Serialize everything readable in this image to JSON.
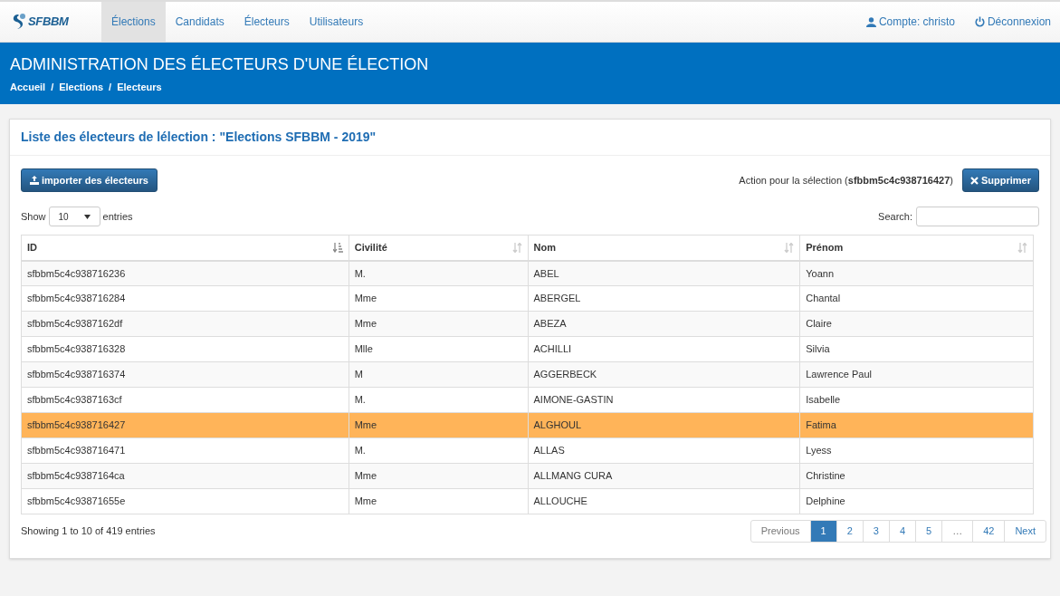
{
  "navbar": {
    "logo_text": "SFBBM",
    "items": [
      {
        "label": "Élections",
        "selected": true
      },
      {
        "label": "Candidats",
        "selected": false
      },
      {
        "label": "Électeurs",
        "selected": false
      },
      {
        "label": "Utilisateurs",
        "selected": false
      }
    ],
    "account": "Compte: christo",
    "logout": "Déconnexion"
  },
  "header": {
    "title": "ADMINISTRATION DES ÉLECTEURS D'UNE ÉLECTION",
    "breadcrumb": [
      "Accueil",
      "Elections",
      "Electeurs"
    ],
    "separator": "/"
  },
  "panel": {
    "title": "Liste des électeurs de lélection : \"Elections SFBBM - 2019\"",
    "import_button": "importer des électeurs",
    "action_text": "Action pour la sélection (**sfbbm5c4c938716427**)",
    "delete_button": "Supprimer",
    "length": {
      "before": "Show",
      "value": "10",
      "after": "entries"
    },
    "search_label": "Search:",
    "table": {
      "columns": [
        {
          "label": "ID",
          "sorted": true
        },
        {
          "label": "Civilité",
          "sorted": false
        },
        {
          "label": "Nom",
          "sorted": false
        },
        {
          "label": "Prénom",
          "sorted": false
        }
      ],
      "rows": [
        {
          "cells": [
            "sfbbm5c4c938716236",
            "M.",
            "ABEL",
            "Yoann"
          ],
          "selected": false
        },
        {
          "cells": [
            "sfbbm5c4c938716284",
            "Mme",
            "ABERGEL",
            "Chantal"
          ],
          "selected": false
        },
        {
          "cells": [
            "sfbbm5c4c9387162df",
            "Mme",
            "ABEZA",
            "Claire"
          ],
          "selected": false
        },
        {
          "cells": [
            "sfbbm5c4c938716328",
            "Mlle",
            "ACHILLI",
            "Silvia"
          ],
          "selected": false
        },
        {
          "cells": [
            "sfbbm5c4c938716374",
            "M",
            "AGGERBECK",
            "Lawrence Paul"
          ],
          "selected": false
        },
        {
          "cells": [
            "sfbbm5c4c9387163cf",
            "M.",
            "AIMONE-GASTIN",
            "Isabelle"
          ],
          "selected": false
        },
        {
          "cells": [
            "sfbbm5c4c938716427",
            "Mme",
            "ALGHOUL",
            "Fatima"
          ],
          "selected": true
        },
        {
          "cells": [
            "sfbbm5c4c938716471",
            "M.",
            "ALLAS",
            "Lyess"
          ],
          "selected": false
        },
        {
          "cells": [
            "sfbbm5c4c9387164ca",
            "Mme",
            "ALLMANG CURA",
            "Christine"
          ],
          "selected": false
        },
        {
          "cells": [
            "sfbbm5c4c93871655e",
            "Mme",
            "ALLOUCHE",
            "Delphine"
          ],
          "selected": false
        }
      ]
    },
    "info": "Showing 1 to 10 of 419 entries",
    "pagination": [
      {
        "label": "Previous",
        "selected": false,
        "disabled": true
      },
      {
        "label": "1",
        "selected": true,
        "disabled": false
      },
      {
        "label": "2",
        "selected": false,
        "disabled": false
      },
      {
        "label": "3",
        "selected": false,
        "disabled": false
      },
      {
        "label": "4",
        "selected": false,
        "disabled": false
      },
      {
        "label": "5",
        "selected": false,
        "disabled": false
      },
      {
        "label": "…",
        "selected": false,
        "disabled": true
      },
      {
        "label": "42",
        "selected": false,
        "disabled": false
      },
      {
        "label": "Next",
        "selected": false,
        "disabled": false
      }
    ]
  }
}
